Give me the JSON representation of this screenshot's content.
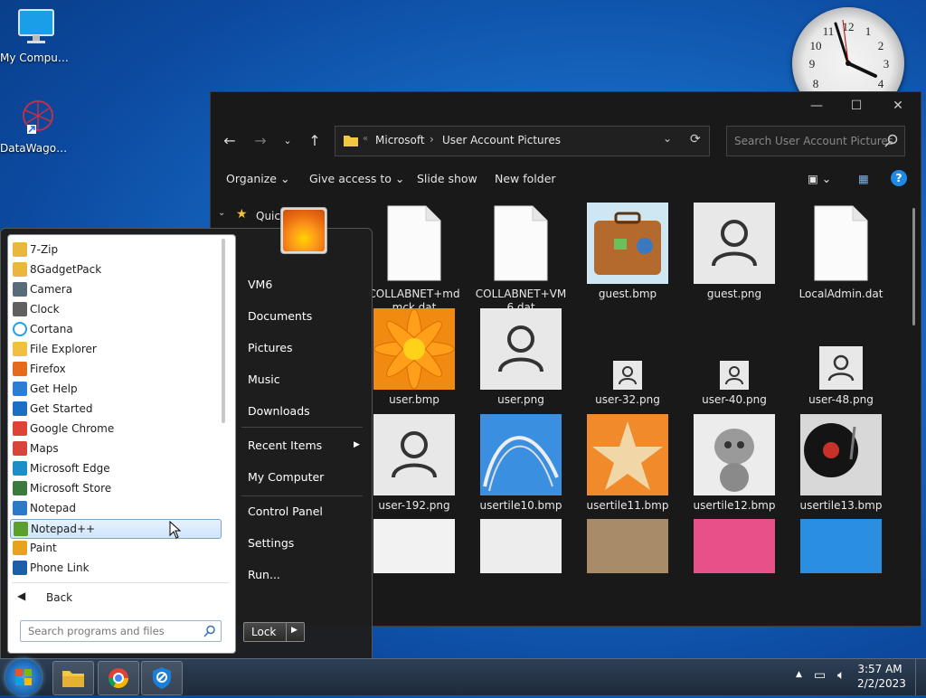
{
  "desktop": {
    "icons": [
      {
        "label": "My Computer",
        "icon": "monitor-icon"
      },
      {
        "label": "DataWagon...",
        "icon": "datawagon-icon"
      }
    ]
  },
  "explorer": {
    "breadcrumb": [
      "Microsoft",
      "User Account Pictures"
    ],
    "search_placeholder": "Search User Account Pictures",
    "commands": [
      "Organize",
      "Give access to",
      "Slide show",
      "New folder"
    ],
    "nav_item": "Quic",
    "files": [
      {
        "name": "COLLABNET+mdmck.dat",
        "kind": "doc"
      },
      {
        "name": "COLLABNET+VM6.dat",
        "kind": "doc"
      },
      {
        "name": "guest.bmp",
        "kind": "suitcase"
      },
      {
        "name": "guest.png",
        "kind": "user"
      },
      {
        "name": "LocalAdmin.dat",
        "kind": "doc"
      },
      {
        "name": "user.bmp",
        "kind": "flower"
      },
      {
        "name": "user.png",
        "kind": "user"
      },
      {
        "name": "user-32.png",
        "kind": "user-small"
      },
      {
        "name": "user-40.png",
        "kind": "user-small"
      },
      {
        "name": "user-48.png",
        "kind": "user-mid"
      },
      {
        "name": "user-192.png",
        "kind": "user"
      },
      {
        "name": "usertile10.bmp",
        "kind": "coaster"
      },
      {
        "name": "usertile11.bmp",
        "kind": "starfish"
      },
      {
        "name": "usertile12.bmp",
        "kind": "robot"
      },
      {
        "name": "usertile13.bmp",
        "kind": "record"
      }
    ]
  },
  "start_menu": {
    "programs": [
      {
        "label": "7-Zip",
        "icon": "folder-icon",
        "color": "#e8b73b"
      },
      {
        "label": "8GadgetPack",
        "icon": "folder-icon",
        "color": "#e8b73b"
      },
      {
        "label": "Camera",
        "icon": "camera-icon",
        "color": "#5a6b7b"
      },
      {
        "label": "Clock",
        "icon": "clock-icon",
        "color": "#606060"
      },
      {
        "label": "Cortana",
        "icon": "cortana-icon",
        "color": "#1ea1e6"
      },
      {
        "label": "File Explorer",
        "icon": "folder-icon",
        "color": "#f0c040"
      },
      {
        "label": "Firefox",
        "icon": "firefox-icon",
        "color": "#e66a1e"
      },
      {
        "label": "Get Help",
        "icon": "help-icon",
        "color": "#2a7fd4"
      },
      {
        "label": "Get Started",
        "icon": "star-icon",
        "color": "#1a6fc2"
      },
      {
        "label": "Google Chrome",
        "icon": "chrome-icon",
        "color": "#db4437"
      },
      {
        "label": "Maps",
        "icon": "maps-icon",
        "color": "#d8453a"
      },
      {
        "label": "Microsoft Edge",
        "icon": "edge-icon",
        "color": "#1e8fc6"
      },
      {
        "label": "Microsoft Store",
        "icon": "store-icon",
        "color": "#3a7a3a"
      },
      {
        "label": "Notepad",
        "icon": "notepad-icon",
        "color": "#2a7ac8"
      },
      {
        "label": "Notepad++",
        "icon": "notepadpp-icon",
        "color": "#5aa02c"
      },
      {
        "label": "Paint",
        "icon": "paint-icon",
        "color": "#e6a41e"
      },
      {
        "label": "Phone Link",
        "icon": "phone-icon",
        "color": "#1a5fa8"
      }
    ],
    "selected": "Notepad++",
    "back_label": "Back",
    "search_placeholder": "Search programs and files",
    "right_items": [
      "VM6",
      "Documents",
      "Pictures",
      "Music",
      "Downloads",
      "Recent Items",
      "My Computer",
      "Control Panel",
      "Settings",
      "Run..."
    ],
    "lock_label": "Lock"
  },
  "taskbar": {
    "time": "3:57 AM",
    "date": "2/2/2023"
  }
}
